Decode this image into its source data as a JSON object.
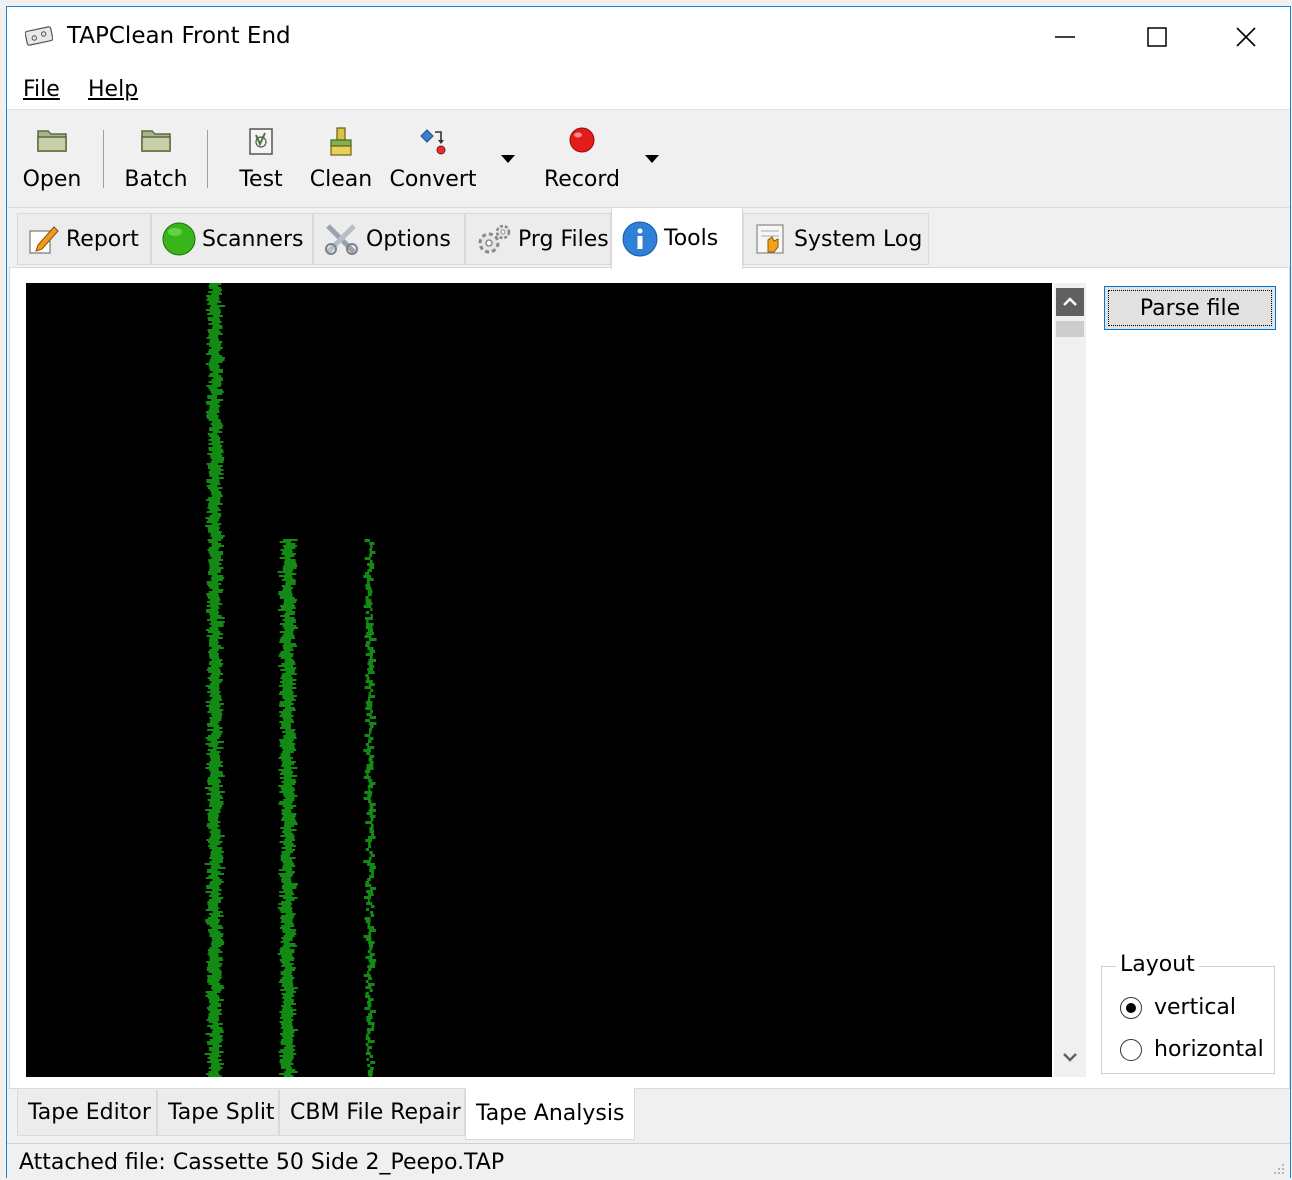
{
  "window": {
    "title": "TAPClean Front End",
    "controls": {
      "minimize": "—",
      "maximize": "☐",
      "close": "✕"
    }
  },
  "menu": {
    "items": [
      {
        "label": "File",
        "mnemonic": "F"
      },
      {
        "label": "Help",
        "mnemonic": "H"
      }
    ]
  },
  "toolbar": {
    "buttons": [
      {
        "label": "Open",
        "icon": "folder-icon"
      },
      {
        "label": "Batch",
        "icon": "folder-icon"
      },
      {
        "label": "Test",
        "icon": "test-icon"
      },
      {
        "label": "Clean",
        "icon": "broom-icon"
      },
      {
        "label": "Convert",
        "icon": "convert-icon"
      },
      {
        "label": "Record",
        "icon": "record-icon"
      }
    ]
  },
  "tabs": [
    {
      "label": "Report",
      "icon": "pencil-icon",
      "active": false
    },
    {
      "label": "Scanners",
      "icon": "green-circle-icon",
      "active": false
    },
    {
      "label": "Options",
      "icon": "tools-icon",
      "active": false
    },
    {
      "label": "Prg Files",
      "icon": "gear-icon",
      "active": false
    },
    {
      "label": "Tools",
      "icon": "info-icon",
      "active": true
    },
    {
      "label": "System Log",
      "icon": "log-icon",
      "active": false
    }
  ],
  "tools_panel": {
    "parse_button": "Parse file",
    "layout": {
      "legend": "Layout",
      "options": [
        {
          "label": "vertical",
          "selected": true
        },
        {
          "label": "horizontal",
          "selected": false
        }
      ]
    },
    "analysis_colors": {
      "background": "#000000",
      "trace": "#138a13"
    }
  },
  "bottom_tabs": [
    {
      "label": "Tape Editor",
      "active": false
    },
    {
      "label": "Tape Split",
      "active": false
    },
    {
      "label": "CBM File Repair",
      "active": false
    },
    {
      "label": "Tape Analysis",
      "active": true
    }
  ],
  "status": {
    "text": "Attached file: Cassette 50 Side 2_Peepo.TAP"
  }
}
